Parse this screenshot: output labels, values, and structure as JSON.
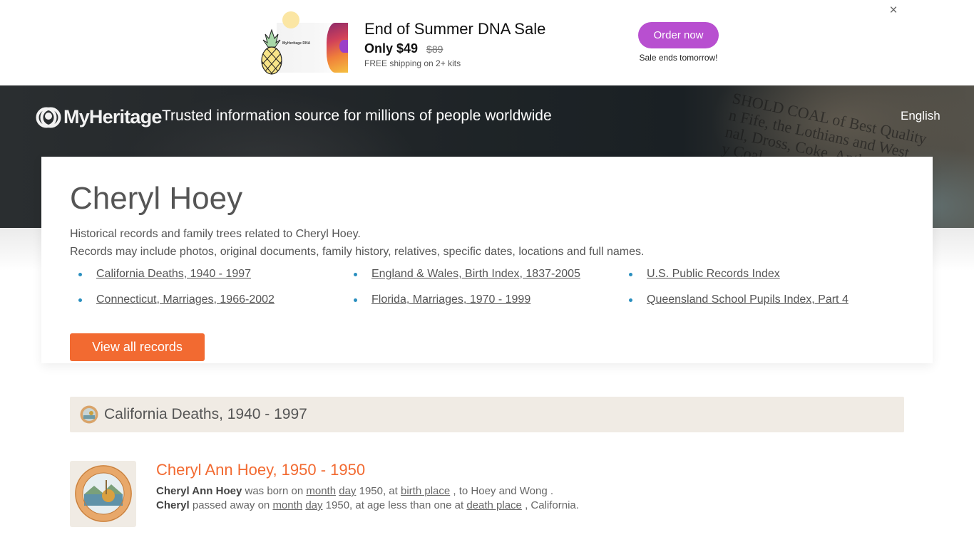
{
  "promo": {
    "image_alt": "MyHeritage DNA kit with pineapple",
    "card_logo": "MyHeritage DNA",
    "title": "End of Summer DNA Sale",
    "price": "Only $49",
    "old_price": "$89",
    "shipping": "FREE shipping on 2+ kits",
    "order_label": "Order now",
    "sale_ends": "Sale ends tomorrow!",
    "close_icon": "×",
    "order_color": "#b84fd0"
  },
  "header": {
    "logo_text": "MyHeritage",
    "tagline": "Trusted information source for millions of people worldwide",
    "language": "English",
    "bg_newspaper_lines": [
      "SHOLD COAL of Best Quality",
      "n Fife, the Lothians and West,",
      "nal, Dross, Coke, Anthracites,",
      "y Coal."
    ]
  },
  "main": {
    "title": "Cheryl Hoey",
    "desc_line1": "Historical records and family trees related to Cheryl Hoey.",
    "desc_line2": "Records may include photos, original documents, family history, relatives, specific dates, locations and full names.",
    "records": [
      "California Deaths, 1940 - 1997",
      "England & Wales, Birth Index, 1837-2005",
      "U.S. Public Records Index",
      "Connecticut, Marriages, 1966-2002",
      "Florida, Marriages, 1970 - 1999",
      "Queensland School Pupils Index, Part 4"
    ],
    "view_all_label": "View all records",
    "accent_color": "#f26a31"
  },
  "section": {
    "title": "California Deaths, 1940 - 1997"
  },
  "result": {
    "title": "Cheryl Ann Hoey, 1950 - 1950",
    "line1": {
      "name": "Cheryl Ann Hoey",
      "t1": " was born on ",
      "month": "month",
      "day": "day",
      "t2": " 1950, at ",
      "place": "birth place",
      "t3": " , to Hoey and Wong ."
    },
    "line2": {
      "name": "Cheryl",
      "t1": " passed away on ",
      "month": "month",
      "day": "day",
      "t2": " 1950, at age less than one at ",
      "place": "death place",
      "t3": " , California."
    }
  }
}
